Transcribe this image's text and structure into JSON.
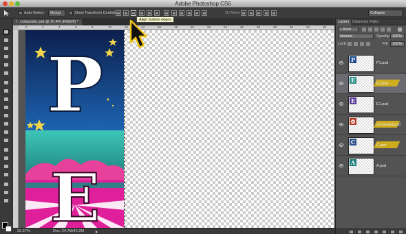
{
  "window": {
    "title": "Adobe Photoshop CS6"
  },
  "options_bar": {
    "auto_select_label": "Auto-Select:",
    "auto_select_value": "Group",
    "show_transform_label": "Show Transform Controls",
    "mode_3d_label": "3D Mode:",
    "workspace_value": "Collapse"
  },
  "tooltip": {
    "text": "Align bottom edges"
  },
  "document": {
    "tab_label": "composite.psd @ 25.4% (RGB/8) *",
    "ruler_ticks": [
      "0",
      "2",
      "4",
      "6",
      "8",
      "10",
      "12",
      "14",
      "16",
      "18",
      "20",
      "22",
      "24",
      "26",
      "28",
      "30",
      "32",
      "34",
      "36"
    ],
    "letter_top": "P",
    "letter_bottom": "E"
  },
  "status_bar": {
    "zoom": "25.37%",
    "doc_info": "Doc: 24.7M/42.2M"
  },
  "colors": {
    "accent_highlight": "#d8b31a",
    "art_blue": "#123a7a",
    "art_teal": "#2fa6a0",
    "art_magenta": "#e0209a"
  },
  "layers_panel": {
    "tabs": [
      "Layers",
      "Channels",
      "Paths"
    ],
    "filter_kind": "Kind",
    "blend_mode": "Normal",
    "opacity_label": "Opacity:",
    "opacity_value": "100%",
    "lock_label": "Lock:",
    "fill_label": "Fill:",
    "fill_value": "100%",
    "layers": [
      {
        "name": "P1.psd",
        "glyph": "P",
        "glyph_bg": "#1d4c8c",
        "highlighted": false,
        "selected": false
      },
      {
        "name": "E1.psd",
        "glyph": "E",
        "glyph_bg": "#2c8f8a",
        "highlighted": true,
        "selected": true
      },
      {
        "name": "E1.psd",
        "glyph": "E",
        "glyph_bg": "#5b3a9a",
        "highlighted": false,
        "selected": false
      },
      {
        "name": "Ornament.psd",
        "glyph": "✿",
        "glyph_bg": "#b8402a",
        "highlighted": true,
        "selected": false
      },
      {
        "name": "C.psd",
        "glyph": "C",
        "glyph_bg": "#2b4f8a",
        "highlighted": true,
        "selected": false
      },
      {
        "name": "A.psd",
        "glyph": "A",
        "glyph_bg": "#1f7f7a",
        "highlighted": false,
        "selected": false
      }
    ]
  }
}
